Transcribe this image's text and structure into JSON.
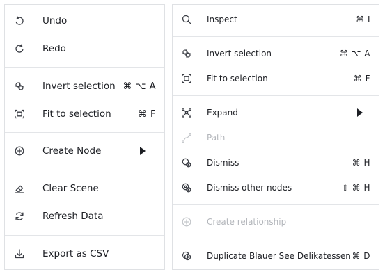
{
  "left_menu": {
    "undo": {
      "label": "Undo",
      "icon": "undo-icon"
    },
    "redo": {
      "label": "Redo",
      "icon": "redo-icon"
    },
    "invert_selection": {
      "label": "Invert selection",
      "shortcut": "⌘ ⌥ A",
      "icon": "invert-selection-icon"
    },
    "fit_to_selection": {
      "label": "Fit to selection",
      "shortcut": "⌘ F",
      "icon": "fit-to-selection-icon"
    },
    "create_node": {
      "label": "Create Node",
      "icon": "plus-circle-icon",
      "has_submenu": true
    },
    "clear_scene": {
      "label": "Clear Scene",
      "icon": "eraser-icon"
    },
    "refresh_data": {
      "label": "Refresh Data",
      "icon": "refresh-icon"
    },
    "export_csv": {
      "label": "Export as CSV",
      "icon": "download-icon"
    }
  },
  "right_menu": {
    "inspect": {
      "label": "Inspect",
      "shortcut": "⌘ I",
      "icon": "search-icon"
    },
    "invert_selection": {
      "label": "Invert selection",
      "shortcut": "⌘ ⌥ A",
      "icon": "invert-selection-icon"
    },
    "fit_to_selection": {
      "label": "Fit to selection",
      "shortcut": "⌘ F",
      "icon": "fit-to-selection-icon"
    },
    "expand": {
      "label": "Expand",
      "icon": "expand-icon",
      "has_submenu": true
    },
    "path": {
      "label": "Path",
      "icon": "path-icon",
      "disabled": true
    },
    "dismiss": {
      "label": "Dismiss",
      "shortcut": "⌘ H",
      "icon": "dismiss-icon"
    },
    "dismiss_other": {
      "label": "Dismiss other nodes",
      "shortcut": "⇧ ⌘ H",
      "icon": "dismiss-other-icon"
    },
    "create_relationship": {
      "label": "Create relationship",
      "icon": "plus-circle-icon",
      "disabled": true
    },
    "duplicate": {
      "label": "Duplicate Blauer See Delikatessen",
      "shortcut": "⌘ D",
      "icon": "duplicate-icon"
    }
  },
  "colors": {
    "text": "#1d1f24",
    "disabled_text": "#b3b6bb",
    "border": "#dfe1e4",
    "separator": "#e3e5e8"
  }
}
